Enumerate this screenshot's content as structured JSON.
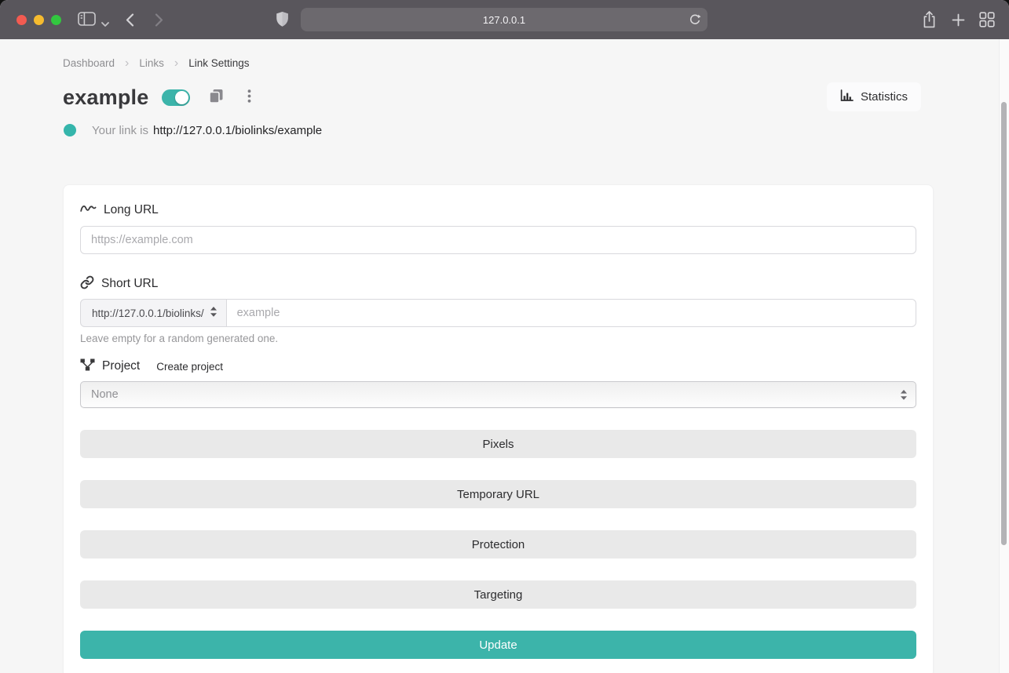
{
  "browser": {
    "url_value": "127.0.0.1"
  },
  "breadcrumb": {
    "separator": "›",
    "items": [
      {
        "label": "Dashboard"
      },
      {
        "label": "Links"
      },
      {
        "label": "Link Settings"
      }
    ]
  },
  "header": {
    "title": "example",
    "toggle_on": true,
    "statistics_label": "Statistics",
    "your_link_prefix": "Your link is",
    "your_link_url": "http://127.0.0.1/biolinks/example"
  },
  "form": {
    "long_url": {
      "label": "Long URL",
      "placeholder": "https://example.com"
    },
    "short_url": {
      "label": "Short URL",
      "domain_option": "http://127.0.0.1/biolinks/",
      "placeholder": "example",
      "helper_text": "Leave empty for a random generated one."
    },
    "project": {
      "label": "Project",
      "create_link": "Create project",
      "selected_option": "None"
    },
    "sections": [
      {
        "label": "Pixels"
      },
      {
        "label": "Temporary URL"
      },
      {
        "label": "Protection"
      },
      {
        "label": "Targeting"
      }
    ],
    "update_label": "Update"
  },
  "icons": {
    "statistics": "bar-chart",
    "long_url": "squiggle-wave",
    "short_url": "chain-link",
    "project": "node-diagram",
    "title_copy": "copy-pages",
    "title_menu": "kebab-dots"
  },
  "colors": {
    "accent_teal": "#3cb4aa",
    "chrome_bg": "#59565c",
    "page_bg": "#f6f6f6",
    "section_button_bg": "#e9e9e9"
  }
}
